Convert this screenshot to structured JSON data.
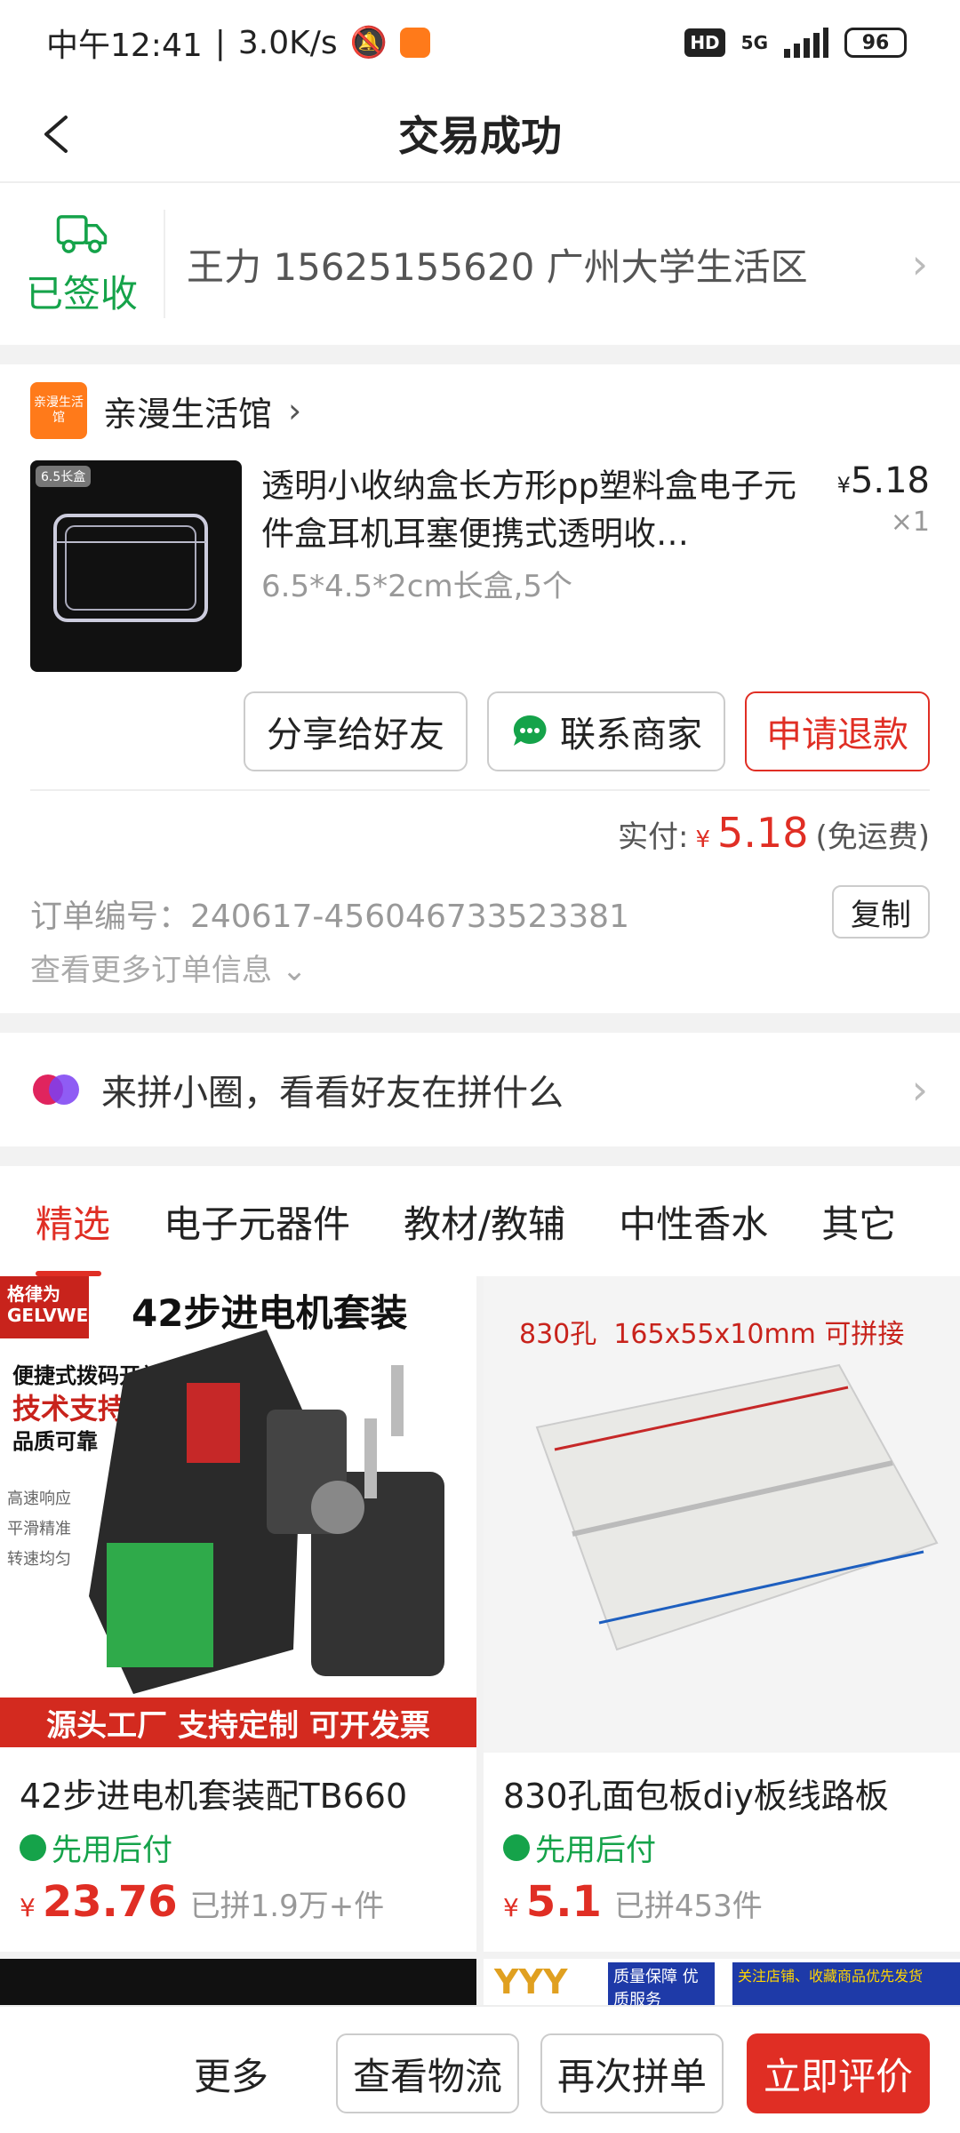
{
  "status_bar": {
    "time": "中午12:41",
    "network": "3.0K/s",
    "hd": "HD",
    "signal_type": "5G",
    "battery": "96"
  },
  "nav": {
    "title": "交易成功"
  },
  "delivery": {
    "status": "已签收",
    "address": "王力 15625155620 广州大学生活区"
  },
  "shop": {
    "logo_text": "亲漫生活馆",
    "name": "亲漫生活馆"
  },
  "product": {
    "title": "透明小收纳盒长方形pp塑料盒电子元件盒耳机耳塞便携式透明收…",
    "spec": "6.5*4.5*2cm长盒,5个",
    "currency": "¥",
    "price": "5.18",
    "qty": "×1",
    "thumb_tag": "6.5长盒"
  },
  "actions": {
    "share": "分享给好友",
    "contact": "联系商家",
    "refund": "申请退款"
  },
  "payment": {
    "label": "实付:",
    "currency": "¥",
    "amount": "5.18",
    "note": "(免运费)"
  },
  "order": {
    "number": "订单编号：240617-456046733523381",
    "copy": "复制",
    "more": "查看更多订单信息"
  },
  "circle": {
    "text": "来拼小圈，看看好友在拼什么"
  },
  "tabs": [
    "精选",
    "电子元器件",
    "教材/教辅",
    "中性香水",
    "其它"
  ],
  "recommendations": [
    {
      "name": "42步进电机套装配TB660",
      "pay_later": "先用后付",
      "currency": "¥",
      "price": "23.76",
      "sold": "已拼1.9万+件",
      "img_headline": "42步进电机套装",
      "img_brand": "格律为 GELVWEI",
      "img_lines": [
        "便捷式拨码开关",
        "技术支持",
        "品质可靠"
      ],
      "img_side": [
        "高速响应",
        "平滑精准",
        "转速均匀"
      ],
      "img_banner": "源头工厂 支持定制 可开发票"
    },
    {
      "name": "830孔面包板diy板线路板",
      "pay_later": "先用后付",
      "currency": "¥",
      "price": "5.1",
      "sold": "已拼453件",
      "img_headline": "830孔  165x55x10mm 可拼接"
    }
  ],
  "partial_tiles": {
    "tile2_text": "YYY",
    "tile2_badge": "质量保障 优质服务",
    "tile2_banner": "关注店铺、收藏商品优先发货"
  },
  "bottom_bar": {
    "more": "更多",
    "logistics": "查看物流",
    "rebuy": "再次拼单",
    "review": "立即评价"
  },
  "colors": {
    "accent_red": "#e02e24",
    "green": "#15a34a",
    "shop_orange": "#ff7a1a"
  }
}
